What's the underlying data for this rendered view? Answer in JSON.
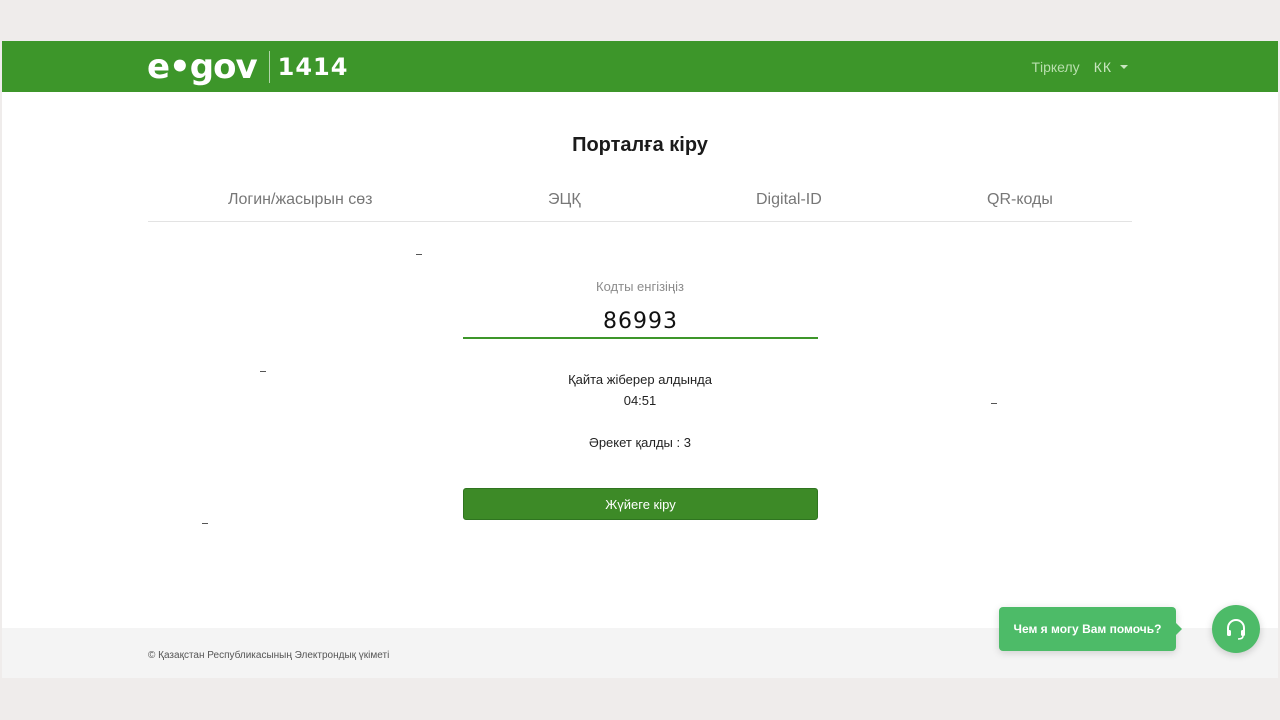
{
  "header": {
    "logo_text": "e•gov",
    "logo_number": "1414",
    "register_label": "Тіркелу",
    "language": "КК"
  },
  "main": {
    "title": "Порталға кіру",
    "tabs": [
      {
        "label": "Логин/жасырын сөз"
      },
      {
        "label": "ЭЦҚ"
      },
      {
        "label": "Digital-ID"
      },
      {
        "label": "QR-коды"
      }
    ],
    "code_field": {
      "label": "Кодты енгізіңіз",
      "value": "86993"
    },
    "resend": {
      "label": "Қайта жіберер алдында",
      "timer": "04:51"
    },
    "attempts": "Әрекет қалды : 3",
    "submit_label": "Жүйеге кіру"
  },
  "footer": {
    "copyright": "© Қазақстан Республикасының Электрондық үкіметі"
  },
  "chat": {
    "bubble_text": "Чем я могу Вам помочь?",
    "icon": "headset-icon"
  },
  "colors": {
    "brand_green": "#3d962a",
    "chat_green": "#4dbb68"
  }
}
